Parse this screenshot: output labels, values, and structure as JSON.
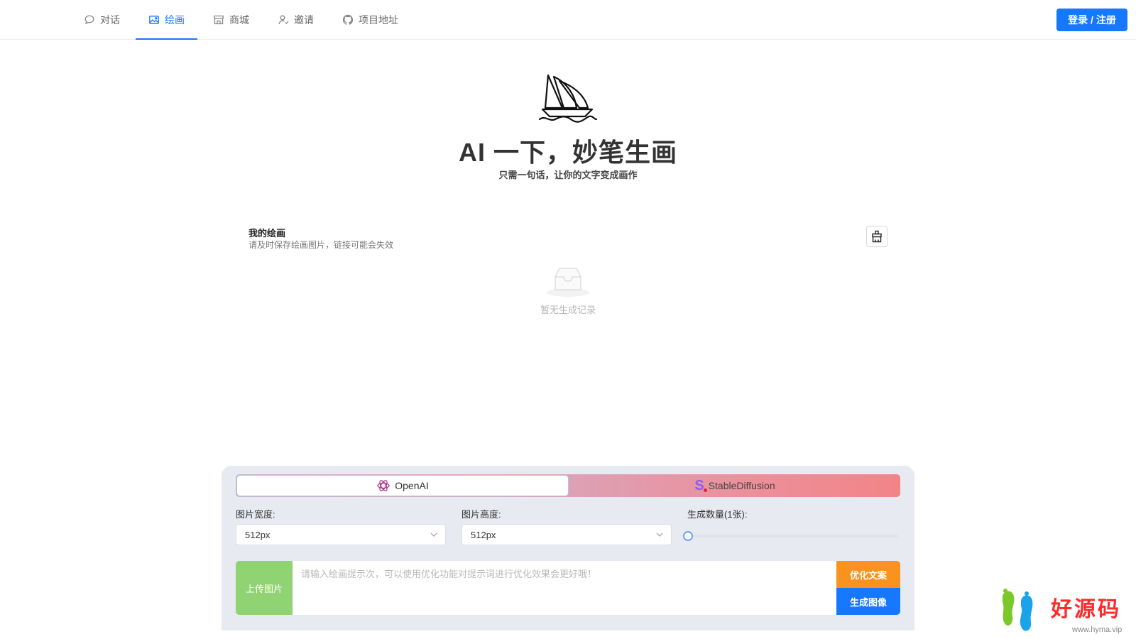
{
  "nav": {
    "items": [
      {
        "label": "对话",
        "icon": "chat-icon",
        "active": false
      },
      {
        "label": "绘画",
        "icon": "image-icon",
        "active": true
      },
      {
        "label": "商城",
        "icon": "store-icon",
        "active": false
      },
      {
        "label": "邀请",
        "icon": "invite-icon",
        "active": false
      },
      {
        "label": "项目地址",
        "icon": "github-icon",
        "active": false
      }
    ],
    "login_label": "登录 / 注册"
  },
  "hero": {
    "title": "AI 一下，妙笔生画",
    "subtitle": "只需一句话，让你的文字变成画作",
    "logo_icon": "sailboat-icon"
  },
  "gallery": {
    "title": "我的绘画",
    "note": "请及时保存绘画图片，链接可能会失效",
    "clear_icon": "broom-icon",
    "empty_text": "暂无生成记录"
  },
  "generator": {
    "models": [
      {
        "label": "OpenAI",
        "icon": "openai-icon",
        "selected": true
      },
      {
        "label": "StableDiffusion",
        "icon": "stable-diffusion-icon",
        "selected": false
      }
    ],
    "sd_mark": "S",
    "width_label": "图片宽度:",
    "width_value": "512px",
    "height_label": "图片高度:",
    "height_value": "512px",
    "count_label": "生成数量(1张):",
    "count_value": 1,
    "upload_label": "上传图片",
    "prompt_placeholder": "请输入绘画提示次，可以使用优化功能对提示词进行优化效果会更好哦！",
    "optimize_label": "优化文案",
    "generate_label": "生成图像"
  },
  "watermark": {
    "text": "好源码",
    "url": "www.hyma.vip"
  },
  "colors": {
    "primary": "#1677ff",
    "optimize": "#f7931e",
    "upload": "#8fd372",
    "panel_bg": "#e8eaf2"
  }
}
